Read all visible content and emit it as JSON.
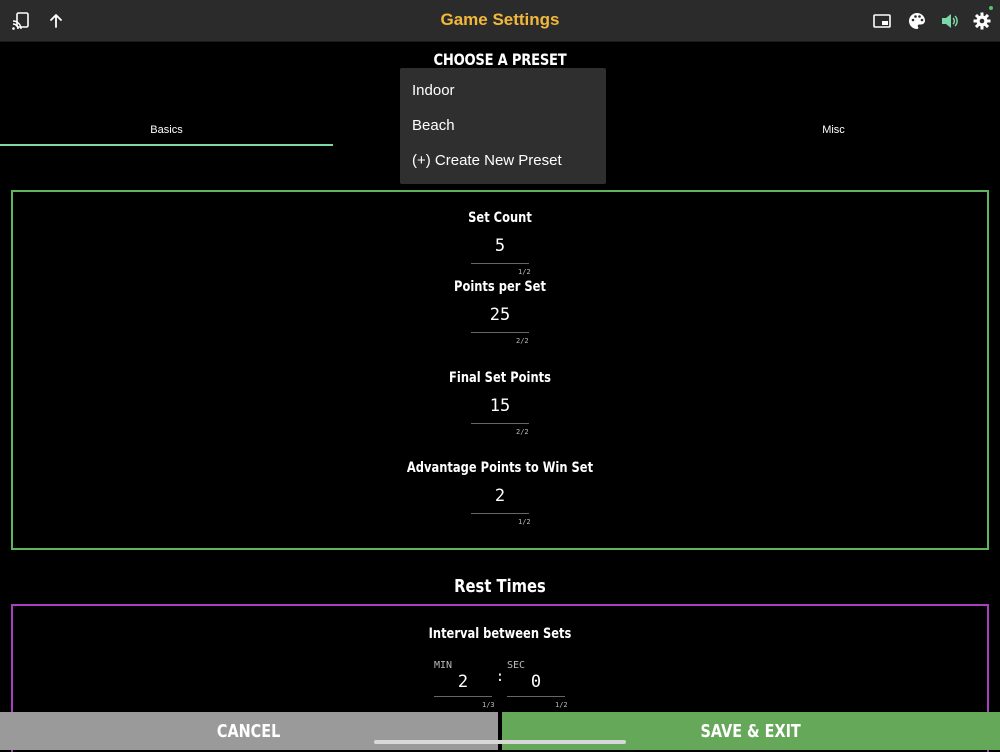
{
  "header": {
    "title": "Game Settings",
    "icons": [
      "cast-icon",
      "arrow-up-icon",
      "picture-in-picture-icon",
      "palette-icon",
      "speaker-icon",
      "gear-icon"
    ],
    "accent": "#f2b83a"
  },
  "preset": {
    "title": "CHOOSE A PRESET",
    "options": [
      "Indoor",
      "Beach",
      "(+) Create New Preset"
    ]
  },
  "tabs": [
    {
      "label": "Basics",
      "selected": true
    },
    {
      "label": "Misc",
      "selected": false
    }
  ],
  "basics": {
    "fields": [
      {
        "label": "Set Count",
        "value": "5",
        "count": "1/2"
      },
      {
        "label": "Points per Set",
        "value": "25",
        "count": "2/2"
      },
      {
        "label": "Final Set Points",
        "value": "15",
        "count": "2/2"
      },
      {
        "label": "Advantage Points to Win Set",
        "value": "2",
        "count": "1/2"
      }
    ],
    "border_color": "#5fb55f"
  },
  "rest": {
    "title": "Rest Times",
    "border_color": "#a83fbf",
    "interval": {
      "label": "Interval between Sets",
      "min_caption": "MIN",
      "sec_caption": "SEC",
      "min_value": "2",
      "sec_value": "0",
      "separator": ":",
      "min_count": "1/3",
      "sec_count": "1/2"
    }
  },
  "actions": {
    "cancel_label": "CANCEL",
    "save_label": "SAVE & EXIT",
    "cancel_color": "#9a9a9a",
    "save_color": "#66a85a"
  }
}
